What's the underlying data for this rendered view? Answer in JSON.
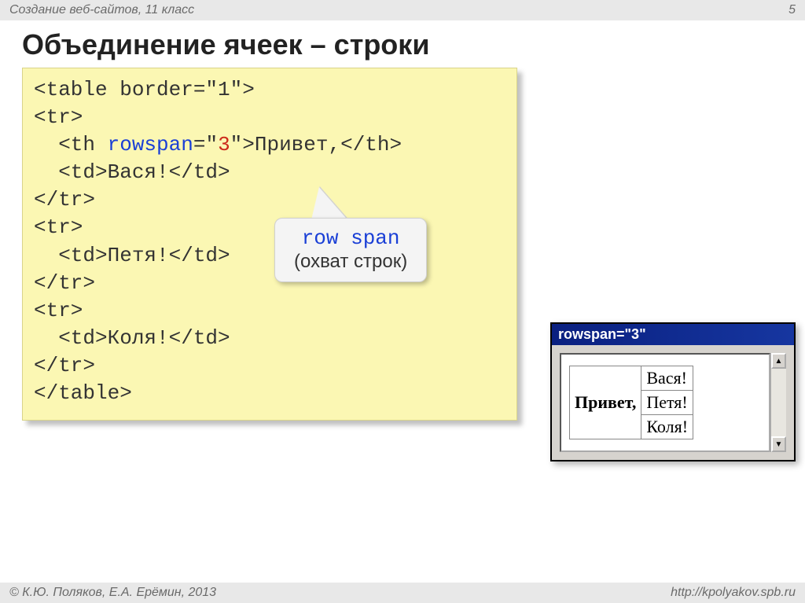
{
  "header": {
    "subject": "Создание веб-сайтов, 11 класс",
    "page_number": "5"
  },
  "title": "Объединение ячеек – строки",
  "code": {
    "l1a": "<table border=\"1\">",
    "l2": "<tr>",
    "l3a": "  <th ",
    "l3b": "rowspan",
    "l3c": "=\"",
    "l3d": "3",
    "l3e": "\">Привет,</th>",
    "l4": "  <td>Вася!</td>",
    "l5": "</tr>",
    "l6": "<tr>",
    "l7": "  <td>Петя!</td>",
    "l8": "</tr>",
    "l9": "<tr>",
    "l10": "  <td>Коля!</td>",
    "l11": "</tr>",
    "l12": "</table>"
  },
  "callout": {
    "line1": "row span",
    "line2": "(охват строк)"
  },
  "browser": {
    "title": "rowspan=\"3\"",
    "table": {
      "header": "Привет,",
      "rows": [
        "Вася!",
        "Петя!",
        "Коля!"
      ]
    },
    "arrow_up": "▲",
    "arrow_down": "▼"
  },
  "footer": {
    "copyright": "© К.Ю. Поляков, Е.А. Ерёмин, 2013",
    "url": "http://kpolyakov.spb.ru"
  }
}
